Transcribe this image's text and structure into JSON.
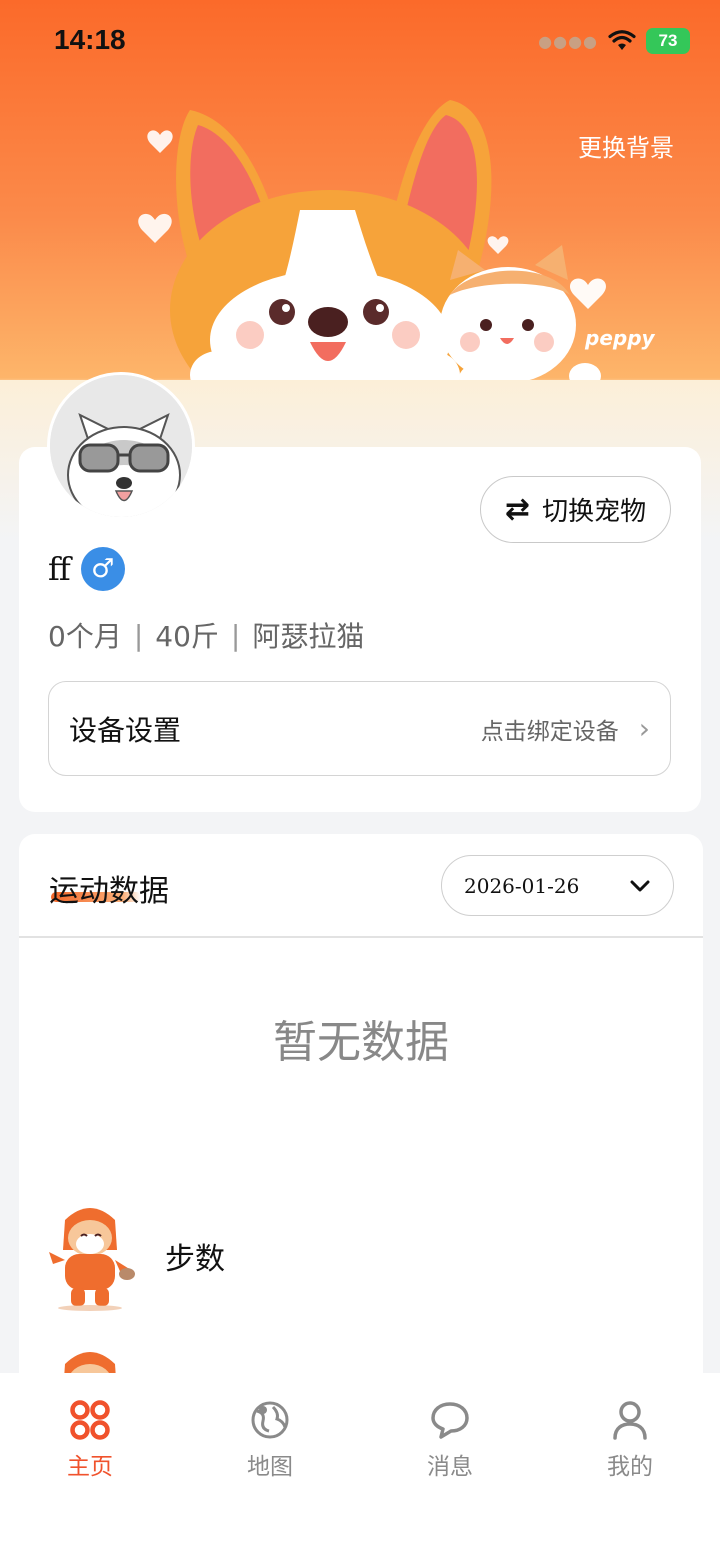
{
  "status_bar": {
    "time": "14:18",
    "battery": "73"
  },
  "hero": {
    "change_background": "更换背景",
    "art_text": "peppy"
  },
  "pet": {
    "name": "ff",
    "gender_symbol": "♂",
    "age": "0个月",
    "weight": "40斤",
    "breed": "阿瑟拉猫",
    "separator": "|",
    "switch_label": "切换宠物",
    "switch_icon_glyph": "⇄"
  },
  "device": {
    "title": "设备设置",
    "hint": "点击绑定设备",
    "chevron": "›"
  },
  "sport": {
    "title": "运动数据",
    "date": "2026-01-26",
    "empty": "暂无数据",
    "metrics": [
      {
        "label": "步数",
        "icon": "shiba-hoodie-icon"
      }
    ]
  },
  "tabs": [
    {
      "label": "主页",
      "icon": "home-icon",
      "active": true
    },
    {
      "label": "地图",
      "icon": "map-icon",
      "active": false
    },
    {
      "label": "消息",
      "icon": "message-icon",
      "active": false
    },
    {
      "label": "我的",
      "icon": "profile-icon",
      "active": false
    }
  ],
  "colors": {
    "accent": "#f0522c",
    "gender": "#3a8ee6",
    "battery": "#34c759"
  }
}
